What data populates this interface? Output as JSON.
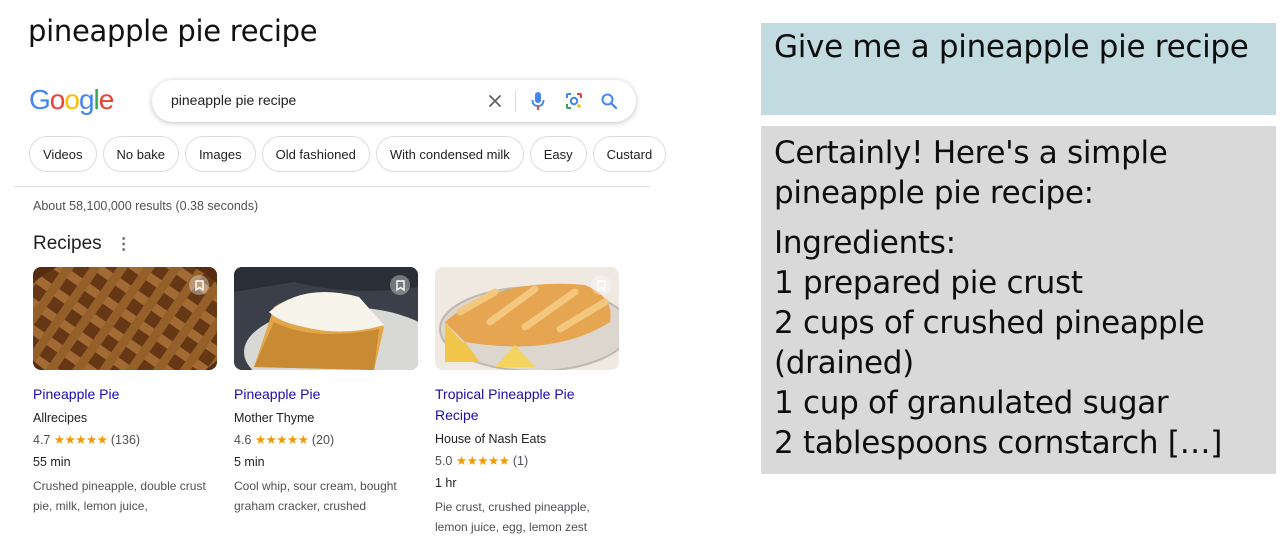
{
  "slide": {
    "title": "pineapple pie recipe"
  },
  "google": {
    "logo_letters": [
      {
        "ch": "G",
        "color": "#4285F4"
      },
      {
        "ch": "o",
        "color": "#EA4335"
      },
      {
        "ch": "o",
        "color": "#FBBC05"
      },
      {
        "ch": "g",
        "color": "#4285F4"
      },
      {
        "ch": "l",
        "color": "#34A853"
      },
      {
        "ch": "e",
        "color": "#EA4335"
      }
    ],
    "search": {
      "query": "pineapple pie recipe",
      "icons": [
        "close-icon",
        "mic-icon",
        "lens-icon",
        "search-icon"
      ]
    },
    "chips": [
      "Videos",
      "No bake",
      "Images",
      "Old fashioned",
      "With condensed milk",
      "Easy",
      "Custard"
    ],
    "stats": "About 58,100,000 results (0.38 seconds)",
    "recipes_heading": "Recipes",
    "recipes": [
      {
        "title": "Pineapple Pie",
        "source": "Allrecipes",
        "rating": "4.7",
        "stars": "★★★★★",
        "count": "(136)",
        "time": "55 min",
        "ingredients": "Crushed pineapple, double crust pie, milk, lemon juice,"
      },
      {
        "title": "Pineapple Pie",
        "source": "Mother Thyme",
        "rating": "4.6",
        "stars": "★★★★★",
        "count": "(20)",
        "time": "5 min",
        "ingredients": "Cool whip, sour cream, bought graham cracker, crushed"
      },
      {
        "title": "Tropical Pineapple Pie Recipe",
        "source": "House of Nash Eats",
        "rating": "5.0",
        "stars": "★★★★★",
        "count": "(1)",
        "time": "1 hr",
        "ingredients": "Pie crust, crushed pineapple, lemon juice, egg, lemon zest"
      }
    ]
  },
  "chat": {
    "prompt": "Give me a pineapple pie recipe",
    "answer_intro": "Certainly! Here's a simple pineapple pie recipe:",
    "ingredients_heading": "Ingredients:",
    "ingredients": [
      "1 prepared pie crust",
      "2 cups of crushed pineapple (drained)",
      "1 cup of granulated sugar",
      "2 tablespoons cornstarch […]"
    ]
  },
  "colors": {
    "prompt_bg": "#c1dbe1",
    "answer_bg": "#d9d9d9",
    "link": "#1a0dab",
    "star": "#f29900"
  }
}
